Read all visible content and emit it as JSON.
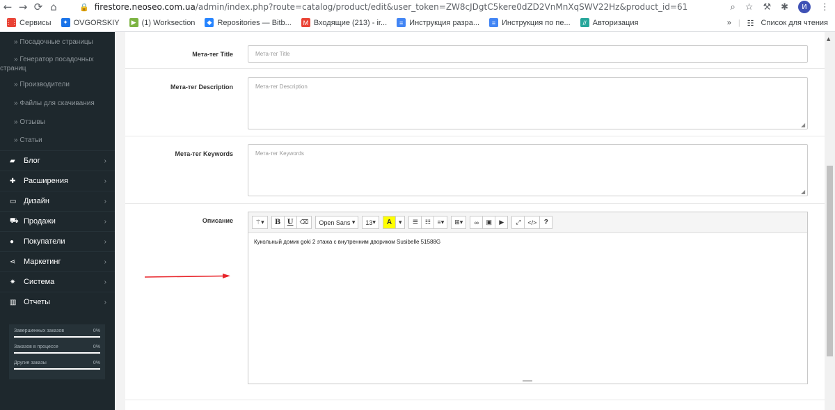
{
  "browser": {
    "url_host": "firestore.neoseo.com.ua",
    "url_path": "/admin/index.php?route=catalog/product/edit&user_token=ZW8cJDgtC5kere0dZD2VnMnXqSWV22Hz&product_id=61",
    "avatar_letter": "И",
    "bookmarks": [
      {
        "label": "Сервисы",
        "icon": "apps-grid-icon",
        "color": "#e94235"
      },
      {
        "label": "OVGORSKIY",
        "icon": "ovgorskiy-icon",
        "color": "#1a73e8"
      },
      {
        "label": "(1) Worksection",
        "icon": "play-icon",
        "color": "#7cb342"
      },
      {
        "label": "Repositories — Bitb...",
        "icon": "bitbucket-icon",
        "color": "#2684ff"
      },
      {
        "label": "Входящие (213) - ir...",
        "icon": "gmail-icon",
        "color": "#ea4335"
      },
      {
        "label": "Инструкция разра...",
        "icon": "docs-icon",
        "color": "#4285f4"
      },
      {
        "label": "Инструкция по пе...",
        "icon": "docs-icon",
        "color": "#4285f4"
      },
      {
        "label": "Авторизация",
        "icon": "auth-icon",
        "color": "#26a69a"
      }
    ],
    "more": "»",
    "reading_list": "Список для чтения"
  },
  "sidebar": {
    "sub_items": [
      {
        "label": "»  Посадочные страницы"
      },
      {
        "label": "»  Генератор посадочных",
        "label2": "страниц"
      },
      {
        "label": "»  Производители"
      },
      {
        "label": "»  Файлы для скачивания"
      },
      {
        "label": "»  Отзывы"
      },
      {
        "label": "»  Статьи"
      }
    ],
    "items": [
      {
        "label": "Блог",
        "icon": "book-icon"
      },
      {
        "label": "Расширения",
        "icon": "puzzle-icon"
      },
      {
        "label": "Дизайн",
        "icon": "monitor-icon"
      },
      {
        "label": "Продажи",
        "icon": "cart-icon"
      },
      {
        "label": "Покупатели",
        "icon": "user-icon"
      },
      {
        "label": "Маркетинг",
        "icon": "share-icon"
      },
      {
        "label": "Система",
        "icon": "gear-icon"
      },
      {
        "label": "Отчеты",
        "icon": "bar-chart-icon"
      }
    ],
    "stats": [
      {
        "label": "Завершенных заказов",
        "value": "0%"
      },
      {
        "label": "Заказов в процессе",
        "value": "0%"
      },
      {
        "label": "Другие заказы",
        "value": "0%"
      }
    ]
  },
  "form": {
    "meta_title": {
      "label": "Мета-тег Title",
      "placeholder": "Мета-тег Title"
    },
    "meta_description": {
      "label": "Мета-тег Description",
      "placeholder": "Мета-тег Description"
    },
    "meta_keywords": {
      "label": "Мета-тег Keywords",
      "placeholder": "Мета-тег Keywords"
    },
    "description": {
      "label": "Описание",
      "font_name": "Open Sans",
      "font_size": "13",
      "content": "Кукольный домик goki 2 этажа с внутренним двориком Susibelle 51588G"
    }
  },
  "colors": {
    "sidebar_bg": "#1e282d",
    "arrow": "#e8242a"
  }
}
